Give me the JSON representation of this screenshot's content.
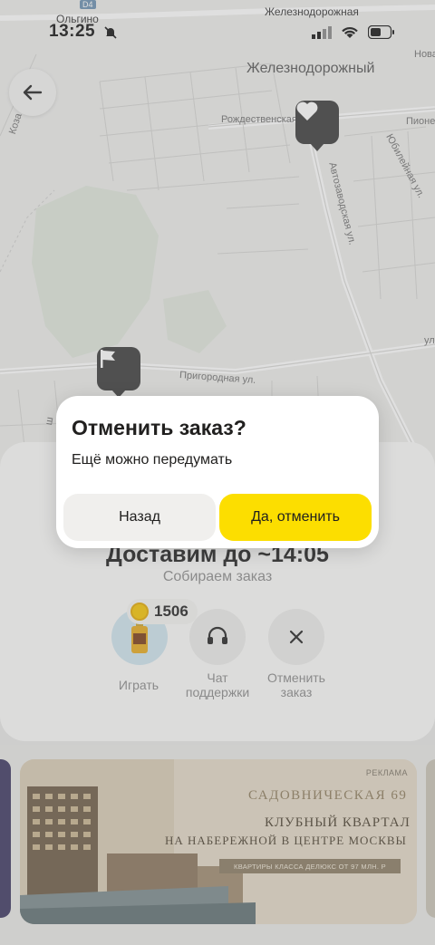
{
  "status_bar": {
    "time": "13:25",
    "top_label_left": "Ольгино",
    "top_label_right": "Железнодорожная",
    "metro_badge": "D4"
  },
  "map": {
    "district_label": "Железнодорожный",
    "streets": {
      "rozhdestvenskaya": "Рождественская",
      "avtozavodskaya": "Автозаводская ул.",
      "prigorodnaya": "Пригородная ул.",
      "yubileynaya": "Юбилейная ул.",
      "pioner": "Пионер",
      "nova": "Нова",
      "koz": "Коза",
      "ul_edge": "ул",
      "sh_edge": "ш"
    },
    "icons": {
      "back": "arrow-left-icon",
      "store_pin": "heart-icon",
      "destination_pin": "flag-icon"
    }
  },
  "order": {
    "eta_title": "Доставим до ~14:05",
    "status": "Собираем заказ",
    "coins": "1506",
    "actions": [
      {
        "label": "Играть",
        "icon": "game-icon"
      },
      {
        "label": "Чат поддержки",
        "icon": "headset-icon"
      },
      {
        "label": "Отменить заказ",
        "icon": "close-icon"
      }
    ]
  },
  "ad": {
    "tag": "РЕКЛАМА",
    "brand": "САДОВНИЧЕСКАЯ 69",
    "headline_1": "КЛУБНЫЙ КВАРТАЛ",
    "headline_2": "НА НАБЕРЕЖНОЙ В ЦЕНТРЕ МОСКВЫ",
    "offer": "КВАРТИРЫ КЛАССА ДЕЛЮКС ОТ 97 МЛН. Р"
  },
  "dialog": {
    "title": "Отменить заказ?",
    "text": "Ещё можно передумать",
    "back_label": "Назад",
    "confirm_label": "Да, отменить"
  },
  "colors": {
    "accent_yellow": "#fcde00",
    "pin_dark": "#3a3a3a",
    "dialog_bg": "#ffffff"
  }
}
